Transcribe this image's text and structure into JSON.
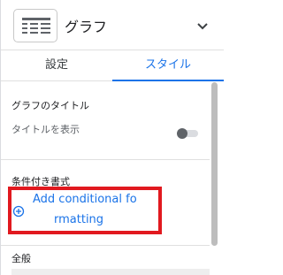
{
  "header": {
    "title": "グラフ",
    "chart_icon": "chart-table-icon",
    "chevron_icon": "chevron-down-icon"
  },
  "tabs": [
    {
      "label": "設定",
      "active": false
    },
    {
      "label": "スタイル",
      "active": true
    }
  ],
  "chart_title_section": {
    "heading": "グラフのタイトル",
    "show_title_label": "タイトルを表示",
    "show_title_enabled": false
  },
  "conditional_format": {
    "heading": "条件付き書式",
    "add_label_line1": "Add conditional fo",
    "add_label_line2": "rmatting",
    "add_icon": "add-circle-icon"
  },
  "general": {
    "heading": "全般"
  },
  "colors": {
    "accent": "#1a73e8",
    "highlight": "#e1191f"
  }
}
